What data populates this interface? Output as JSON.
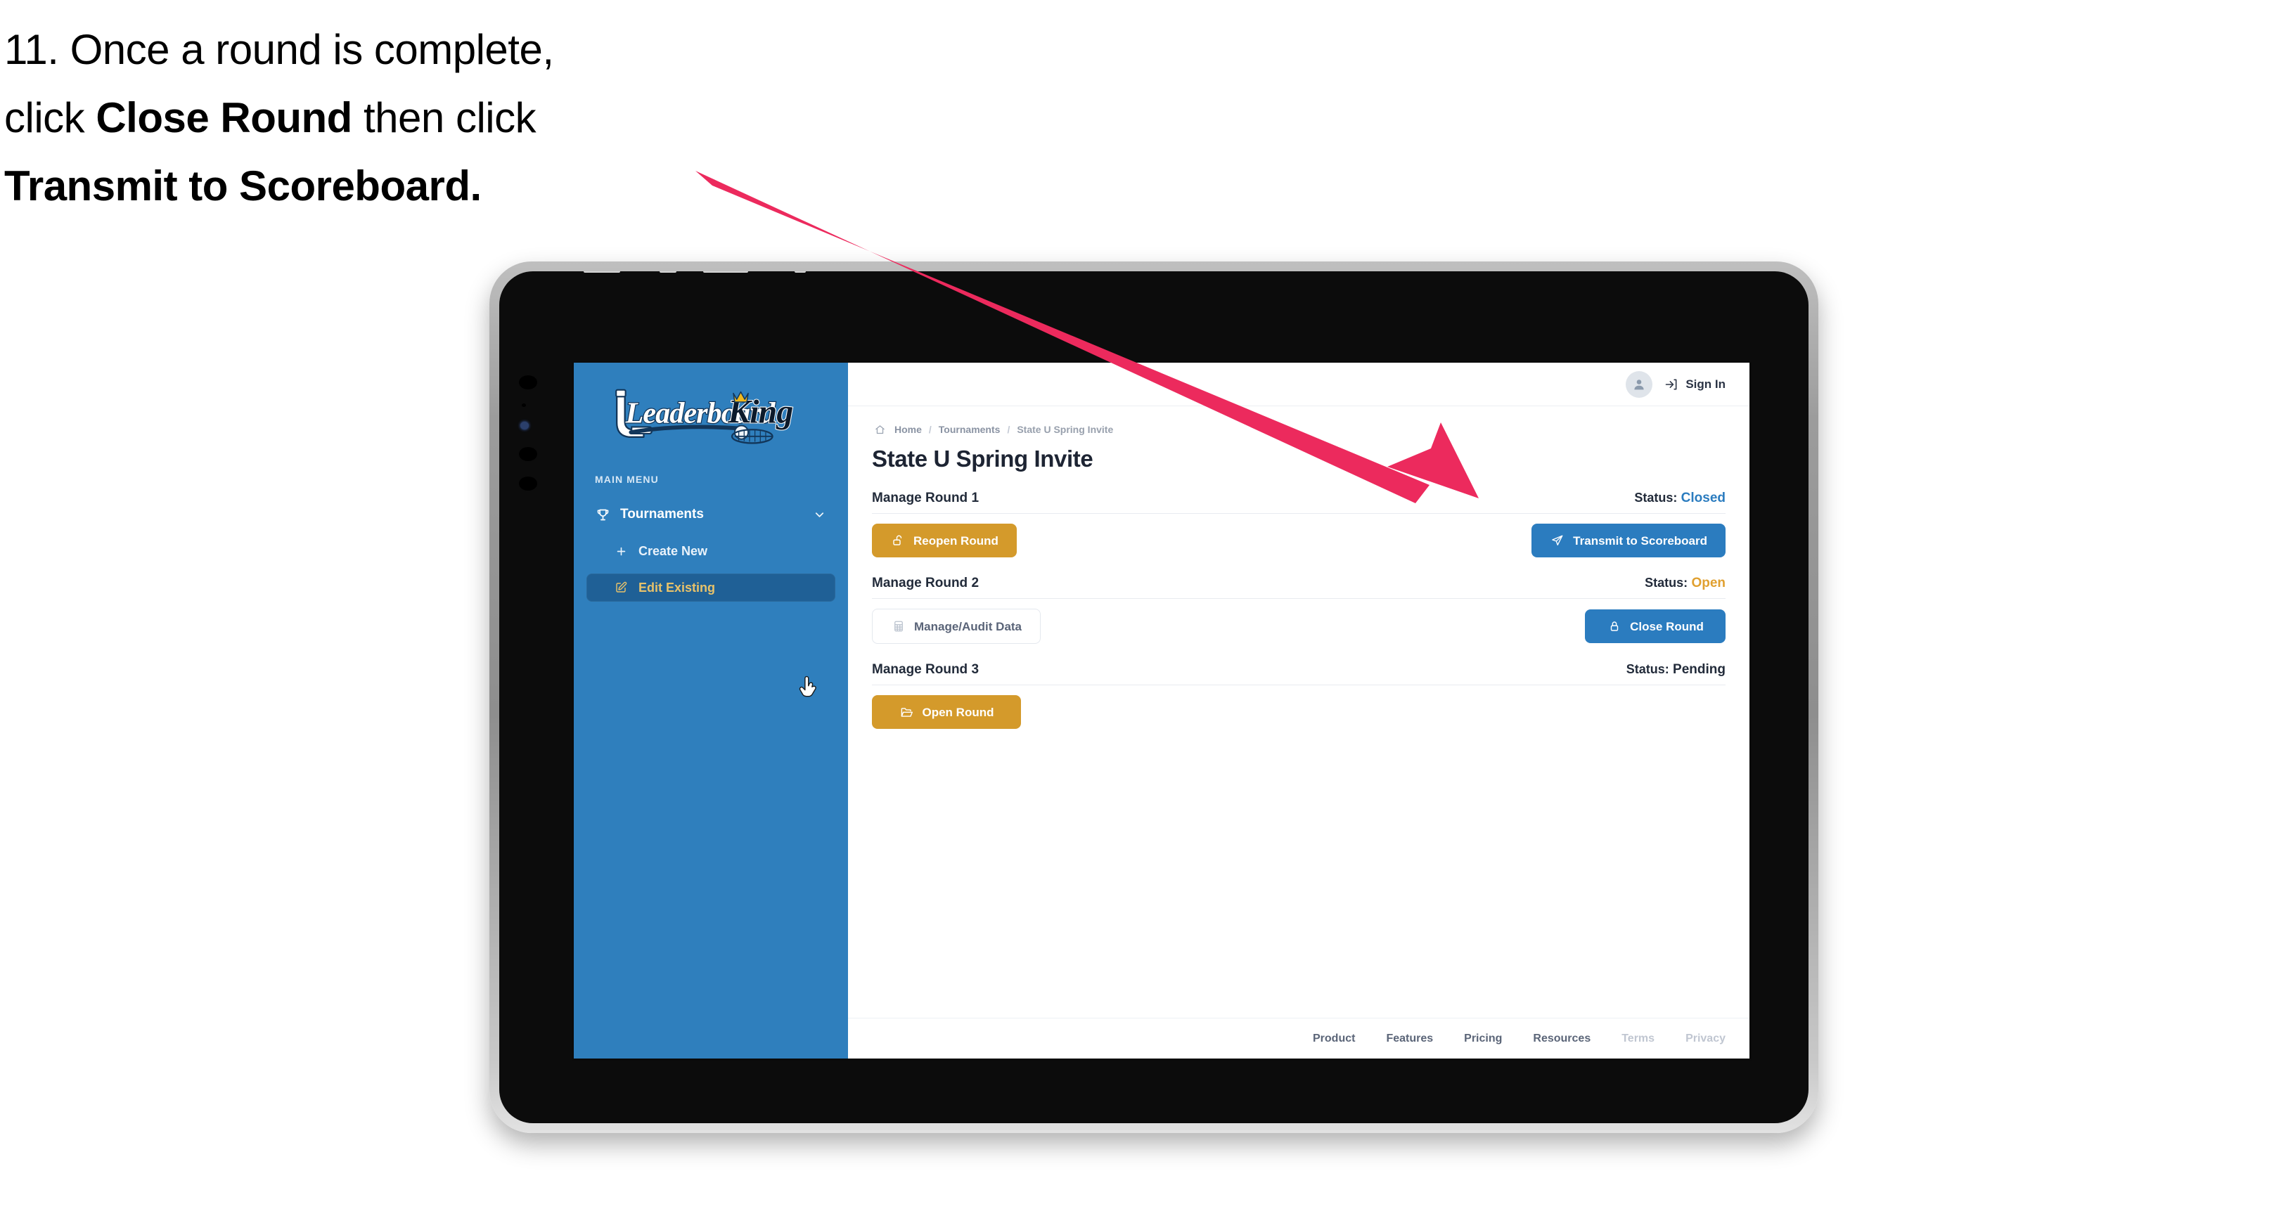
{
  "caption": {
    "line1_a": "11. Once a round is complete,",
    "line2_a": "click ",
    "line2_b": "Close Round",
    "line2_c": " then click",
    "line3_b": "Transmit to Scoreboard."
  },
  "colors": {
    "arrow": "#ec2a5d",
    "sidebar_blue": "#2f7fbd",
    "sidebar_active": "#1f6096",
    "gold": "#d49a2b",
    "blue": "#2b7cbf",
    "status_closed": "#2b7cbf",
    "status_open": "#e0a030",
    "status_pending": "#222b3a",
    "active_label": "#e8c26a"
  },
  "sidebar": {
    "logo_text_left": "Leaderboard",
    "logo_text_right": "King",
    "section_label": "MAIN MENU",
    "items": [
      {
        "label": "Tournaments",
        "icon": "trophy-icon",
        "chevron": "chevron-down-icon",
        "active": false
      },
      {
        "label": "Create New",
        "icon": "plus-icon",
        "active": false
      },
      {
        "label": "Edit Existing",
        "icon": "edit-square-icon",
        "active": true
      }
    ]
  },
  "topbar": {
    "avatar_icon": "user-avatar-icon",
    "signin_icon": "login-arrow-icon",
    "signin_label": "Sign In"
  },
  "breadcrumb": {
    "home_icon": "home-icon",
    "items": [
      "Home",
      "Tournaments",
      "State U Spring Invite"
    ],
    "separator": "/"
  },
  "page": {
    "title": "State U Spring Invite"
  },
  "rounds": [
    {
      "name": "Manage Round 1",
      "status_label": "Status:",
      "status_value": "Closed",
      "status_color": "#2b7cbf",
      "left_button": {
        "label": "Reopen Round",
        "icon": "unlock-icon",
        "style": "gold"
      },
      "right_button": {
        "label": "Transmit to Scoreboard",
        "icon": "paper-plane-icon",
        "style": "blue"
      }
    },
    {
      "name": "Manage Round 2",
      "status_label": "Status:",
      "status_value": "Open",
      "status_color": "#e0a030",
      "left_button": {
        "label": "Manage/Audit Data",
        "icon": "spreadsheet-icon",
        "style": "ghost"
      },
      "right_button": {
        "label": "Close Round",
        "icon": "lock-icon",
        "style": "blue"
      }
    },
    {
      "name": "Manage Round 3",
      "status_label": "Status:",
      "status_value": "Pending",
      "status_color": "#222b3a",
      "left_button": {
        "label": "Open Round",
        "icon": "open-folder-icon",
        "style": "gold"
      },
      "right_button": null
    }
  ],
  "footer": {
    "links": [
      {
        "label": "Product",
        "muted": false
      },
      {
        "label": "Features",
        "muted": false
      },
      {
        "label": "Pricing",
        "muted": false
      },
      {
        "label": "Resources",
        "muted": false
      },
      {
        "label": "Terms",
        "muted": true
      },
      {
        "label": "Privacy",
        "muted": true
      }
    ]
  }
}
